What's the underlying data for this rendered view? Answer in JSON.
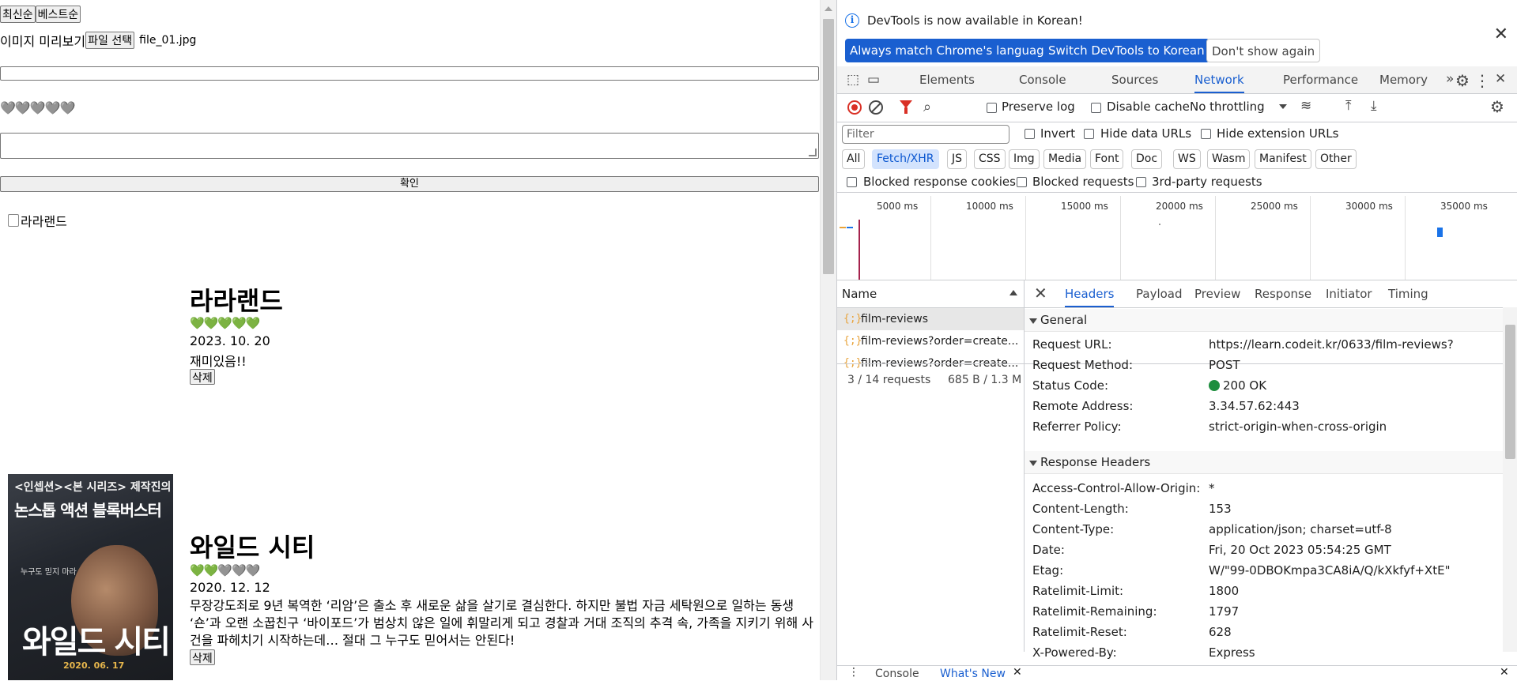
{
  "page": {
    "sort_latest": "최신순",
    "sort_best": "베스트순",
    "preview_alt": "이미지 미리보기",
    "file_button": "파일 선택",
    "file_name": "file_01.jpg",
    "form_rating": "🩶🩶🩶🩶🩶",
    "submit": "확인",
    "reviews": [
      {
        "image_alt": "라라랜드",
        "title": "라라랜드",
        "stars": "💚💚💚💚💚",
        "date": "2023. 10. 20",
        "content": "재미있음!!",
        "delete": "삭제"
      },
      {
        "title": "와일드 시티",
        "stars": "💚💚🩶🩶🩶",
        "date": "2020. 12. 12",
        "content": "무장강도죄로 9년 복역한 ‘리암’은 출소 후 새로운 삶을 살기로 결심한다. 하지만 불법 자금 세탁원으로 일하는 동생 ‘숀’과 오랜 소꿉친구 ‘바이포드’가 범상치 않은 일에 휘말리게 되고 경찰과 거대 조직의 추격 속, 가족을 지키기 위해 사건을 파헤치기 시작하는데… 절대 그 누구도 믿어서는 안된다!",
        "delete": "삭제",
        "poster": {
          "tagline_top": "<인셉션><본 시리즈> 제작진의",
          "tagline_main": "논스톱 액션 블록버스터",
          "side_text": "누구도 믿지 마라",
          "poster_title": "와일드 시티",
          "release": "2020. 06. 17"
        }
      }
    ]
  },
  "devtools": {
    "banner": {
      "message": "DevTools is now available in Korean!",
      "btn_match": "Always match Chrome's language",
      "btn_switch": "Switch DevTools to Korean",
      "btn_dismiss": "Don't show again"
    },
    "tabs": [
      "Elements",
      "Console",
      "Sources",
      "Network",
      "Performance",
      "Memory"
    ],
    "active_tab": "Network",
    "toolbar": {
      "preserve_log": "Preserve log",
      "disable_cache": "Disable cache",
      "throttling": "No throttling"
    },
    "filter": {
      "placeholder": "Filter",
      "invert": "Invert",
      "hide_data_urls": "Hide data URLs",
      "hide_extension_urls": "Hide extension URLs",
      "types": [
        "All",
        "Fetch/XHR",
        "JS",
        "CSS",
        "Img",
        "Media",
        "Font",
        "Doc",
        "WS",
        "Wasm",
        "Manifest",
        "Other"
      ],
      "active_type": "Fetch/XHR",
      "blocked_cookies": "Blocked response cookies",
      "blocked_requests": "Blocked requests",
      "third_party": "3rd-party requests"
    },
    "timeline": [
      "5000 ms",
      "10000 ms",
      "15000 ms",
      "20000 ms",
      "25000 ms",
      "30000 ms",
      "35000 ms"
    ],
    "requests": {
      "header": "Name",
      "items": [
        "film-reviews",
        "film-reviews?order=create...",
        "film-reviews?order=create..."
      ],
      "summary": "3 / 14 requests",
      "transfer": "685 B / 1.3 M"
    },
    "detail_tabs": [
      "Headers",
      "Payload",
      "Preview",
      "Response",
      "Initiator",
      "Timing"
    ],
    "general": {
      "title": "General",
      "rows": [
        {
          "k": "Request URL:",
          "v": "https://learn.codeit.kr/0633/film-reviews?"
        },
        {
          "k": "Request Method:",
          "v": "POST"
        },
        {
          "k": "Status Code:",
          "v": "200 OK"
        },
        {
          "k": "Remote Address:",
          "v": "3.34.57.62:443"
        },
        {
          "k": "Referrer Policy:",
          "v": "strict-origin-when-cross-origin"
        }
      ]
    },
    "response_headers": {
      "title": "Response Headers",
      "rows": [
        {
          "k": "Access-Control-Allow-Origin:",
          "v": "*"
        },
        {
          "k": "Content-Length:",
          "v": "153"
        },
        {
          "k": "Content-Type:",
          "v": "application/json; charset=utf-8"
        },
        {
          "k": "Date:",
          "v": "Fri, 20 Oct 2023 05:54:25 GMT"
        },
        {
          "k": "Etag:",
          "v": "W/\"99-0DBOKmpa3CA8iA/Q/kXkfyf+XtE\""
        },
        {
          "k": "Ratelimit-Limit:",
          "v": "1800"
        },
        {
          "k": "Ratelimit-Remaining:",
          "v": "1797"
        },
        {
          "k": "Ratelimit-Reset:",
          "v": "628"
        },
        {
          "k": "X-Powered-By:",
          "v": "Express"
        }
      ]
    },
    "drawer": {
      "console": "Console",
      "whats_new": "What's New"
    }
  }
}
